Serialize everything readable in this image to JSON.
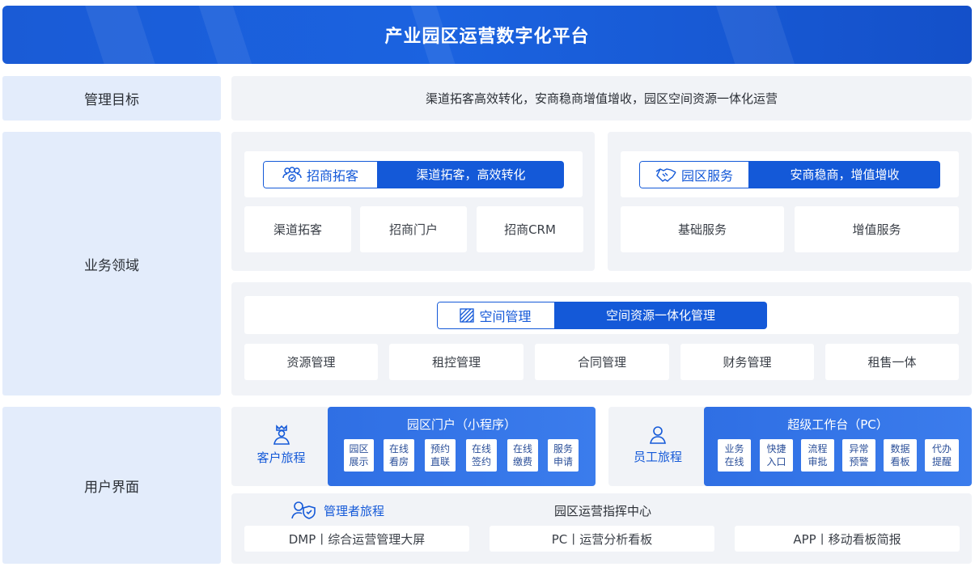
{
  "title": "产业园区运营数字化平台",
  "rows": {
    "mgmt_goal": {
      "label": "管理目标",
      "text": "渠道拓客高效转化，安商稳商增值增收，园区空间资源一体化运营"
    },
    "business": {
      "label": "业务领域",
      "invest": {
        "tag": "招商拓客",
        "desc": "渠道拓客，高效转化",
        "items": [
          "渠道拓客",
          "招商门户",
          "招商CRM"
        ]
      },
      "service": {
        "tag": "园区服务",
        "desc": "安商稳商，增值增收",
        "items": [
          "基础服务",
          "增值服务"
        ]
      },
      "space": {
        "tag": "空间管理",
        "desc": "空间资源一体化管理",
        "items": [
          "资源管理",
          "租控管理",
          "合同管理",
          "财务管理",
          "租售一体"
        ]
      }
    },
    "ui": {
      "label": "用户界面",
      "customer": {
        "label": "客户旅程",
        "portal_title": "园区门户（小程序）",
        "items": [
          {
            "l1": "园区",
            "l2": "展示"
          },
          {
            "l1": "在线",
            "l2": "看房"
          },
          {
            "l1": "预约",
            "l2": "直联"
          },
          {
            "l1": "在线",
            "l2": "签约"
          },
          {
            "l1": "在线",
            "l2": "缴费"
          },
          {
            "l1": "服务",
            "l2": "申请"
          }
        ]
      },
      "employee": {
        "label": "员工旅程",
        "portal_title": "超级工作台（PC）",
        "items": [
          {
            "l1": "业务",
            "l2": "在线"
          },
          {
            "l1": "快捷",
            "l2": "入口"
          },
          {
            "l1": "流程",
            "l2": "审批"
          },
          {
            "l1": "异常",
            "l2": "预警"
          },
          {
            "l1": "数据",
            "l2": "看板"
          },
          {
            "l1": "代办",
            "l2": "提醒"
          }
        ]
      },
      "manager": {
        "label": "管理者旅程",
        "center_title": "园区运营指挥中心",
        "items": [
          "DMP丨综合运营管理大屏",
          "PC丨运营分析看板",
          "APP丨移动看板简报"
        ]
      }
    }
  },
  "colors": {
    "primary": "#1459d8",
    "side_bg": "#e3ecfb",
    "panel_bg": "#f1f3f7",
    "portal_blue": "#3b7cec"
  }
}
